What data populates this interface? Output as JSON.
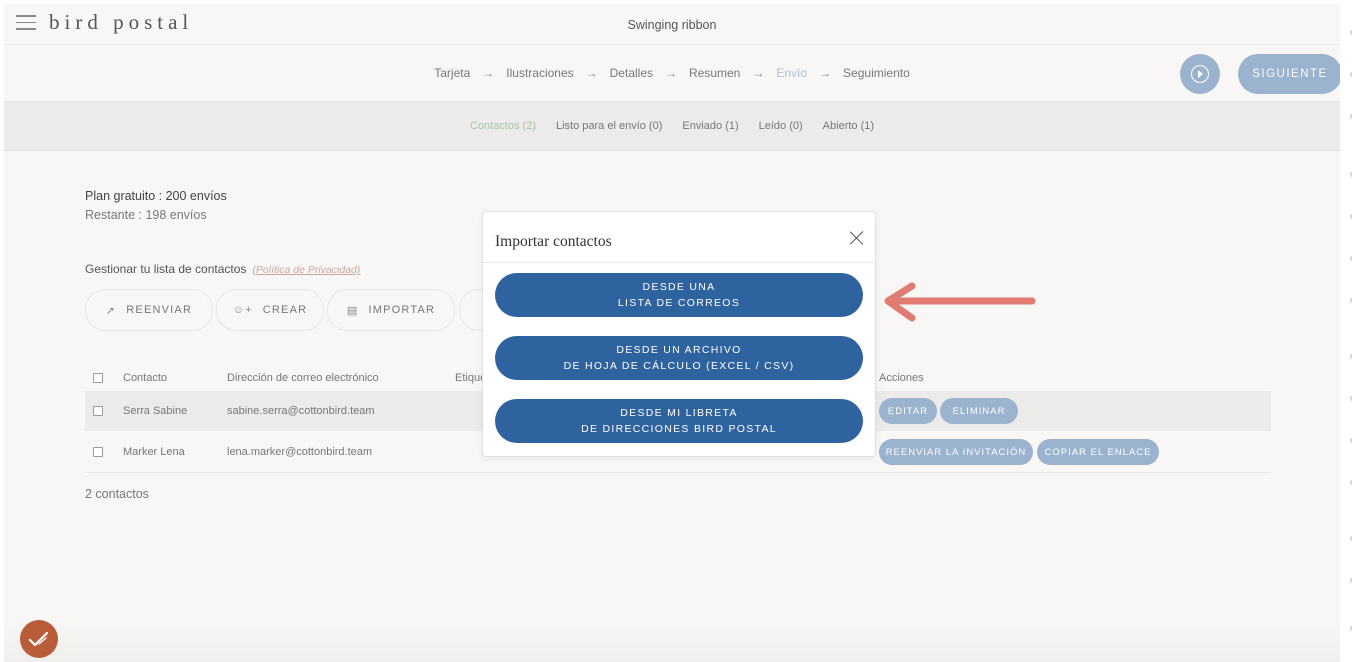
{
  "app": {
    "logo": "bird postal",
    "card_title": "Swinging ribbon"
  },
  "steps": {
    "items": [
      "Tarjeta",
      "Ilustraciones",
      "Detalles",
      "Resumen",
      "Envío",
      "Seguimiento"
    ],
    "arrow": "→",
    "active": "Envío",
    "next_label": "SIGUIENTE"
  },
  "filters": [
    "Contactos (2)",
    "Listo para el envío (0)",
    "Enviado (1)",
    "Leído (0)",
    "Abierto (1)"
  ],
  "plan": {
    "title": "Plan gratuito : 200 envíos",
    "remaining": "Restante : 198 envíos",
    "manage_label": "Gestionar tu lista de contactos",
    "privacy_link": "(Política de Privacidad)"
  },
  "actions": {
    "resend": "REENVIAR",
    "create": "CREAR",
    "import": "IMPORTAR"
  },
  "table": {
    "headers": {
      "contact": "Contacto",
      "email": "Dirección de correo electrónico",
      "tags": "Etique",
      "actions": "Acciones"
    },
    "rows": [
      {
        "name": "Serra Sabine",
        "email": "sabine.serra@cottonbird.team",
        "buttons": [
          "EDITAR",
          "ELIMINAR"
        ]
      },
      {
        "name": "Marker Lena",
        "email": "lena.marker@cottonbird.team",
        "buttons": [
          "REENVIAR LA INVITACIÓN",
          "COPIAR EL ENLACE"
        ]
      }
    ],
    "count": "2 contactos"
  },
  "modal": {
    "title": "Importar contactos",
    "options": [
      {
        "line1": "DESDE UNA",
        "line2": "LISTA DE CORREOS"
      },
      {
        "line1": "DESDE UN ARCHIVO",
        "line2": "DE HOJA DE CÁLCULO (EXCEL / CSV)"
      },
      {
        "line1": "DESDE MI LIBRETA",
        "line2": "DE DIRECCIONES BIRD POSTAL"
      }
    ]
  },
  "colors": {
    "primary": "#2e639f",
    "pill": "#9bb3cf",
    "annotation_arrow": "#e07b72",
    "help_badge": "#b85c3a"
  }
}
